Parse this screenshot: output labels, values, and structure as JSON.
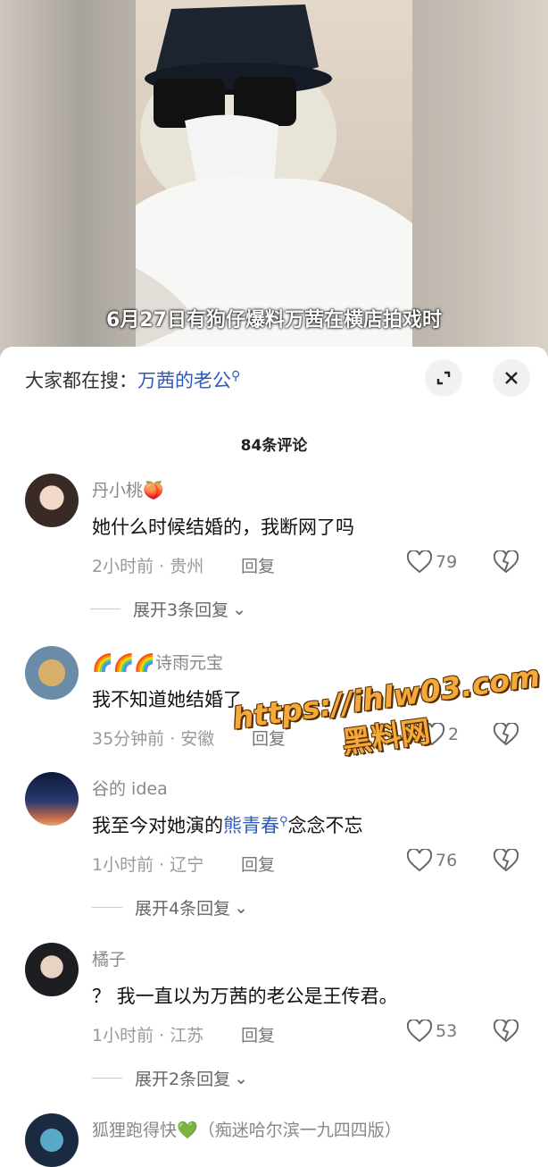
{
  "video": {
    "subtitle": "6月27日有狗仔爆料万茜在横店拍戏时"
  },
  "search": {
    "prefix": "大家都在搜：",
    "keyword": "万茜的老公"
  },
  "header": {
    "comment_count": "84条评论"
  },
  "comments": [
    {
      "user": "丹小桃",
      "user_emoji": "🍑",
      "text": "她什么时候结婚的，我断网了吗",
      "meta": "2小时前 · 贵州",
      "reply": "回复",
      "likes": "79",
      "expand": "展开3条回复"
    },
    {
      "user": "诗雨元宝",
      "user_emoji": "🌈🌈🌈",
      "text": "我不知道她结婚了",
      "meta": "35分钟前 · 安徽",
      "reply": "回复",
      "likes": "2"
    },
    {
      "user": "谷的 idea",
      "text_before": "我至今对她演的",
      "text_link": "熊青春",
      "text_after": "念念不忘",
      "meta": "1小时前 · 辽宁",
      "reply": "回复",
      "likes": "76",
      "expand": "展开4条回复"
    },
    {
      "user": "橘子",
      "text": "？ 我一直以为万茜的老公是王传君。",
      "meta": "1小时前 · 江苏",
      "reply": "回复",
      "likes": "53",
      "expand": "展开2条回复"
    },
    {
      "user": "狐狸跑得快",
      "user_emoji": "💚",
      "user_suffix": "（痴迷哈尔滨一九四四版）"
    }
  ],
  "watermark": {
    "line1": "https://ihlw03.com",
    "line2": "黑料网"
  },
  "colors": {
    "link": "#2b5bbf",
    "watermark": "#f5a93a"
  }
}
